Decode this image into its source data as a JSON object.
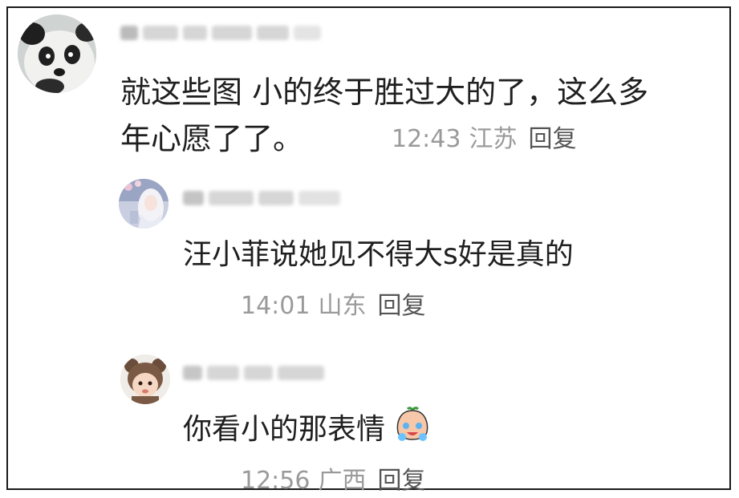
{
  "comments": [
    {
      "text_line1": "就这些图 小的终于胜过大的了，这么多",
      "text_line2": "年心愿了了。",
      "time": "12:43",
      "region": "江苏",
      "reply": "回复",
      "avatar": "panda-avatar"
    },
    {
      "text": "汪小菲说她见不得大s好是真的",
      "time": "14:01",
      "region": "山东",
      "reply": "回复",
      "avatar": "anime-girl-avatar"
    },
    {
      "text": "你看小的那表情",
      "emoji": "crying-face-emoji",
      "time": "12:56",
      "region": "广西",
      "reply": "回复",
      "avatar": "baby-bear-hat-avatar"
    }
  ],
  "colors": {
    "text": "#1f1f1f",
    "meta": "#9a9a9a",
    "border": "#1a1a1a"
  }
}
